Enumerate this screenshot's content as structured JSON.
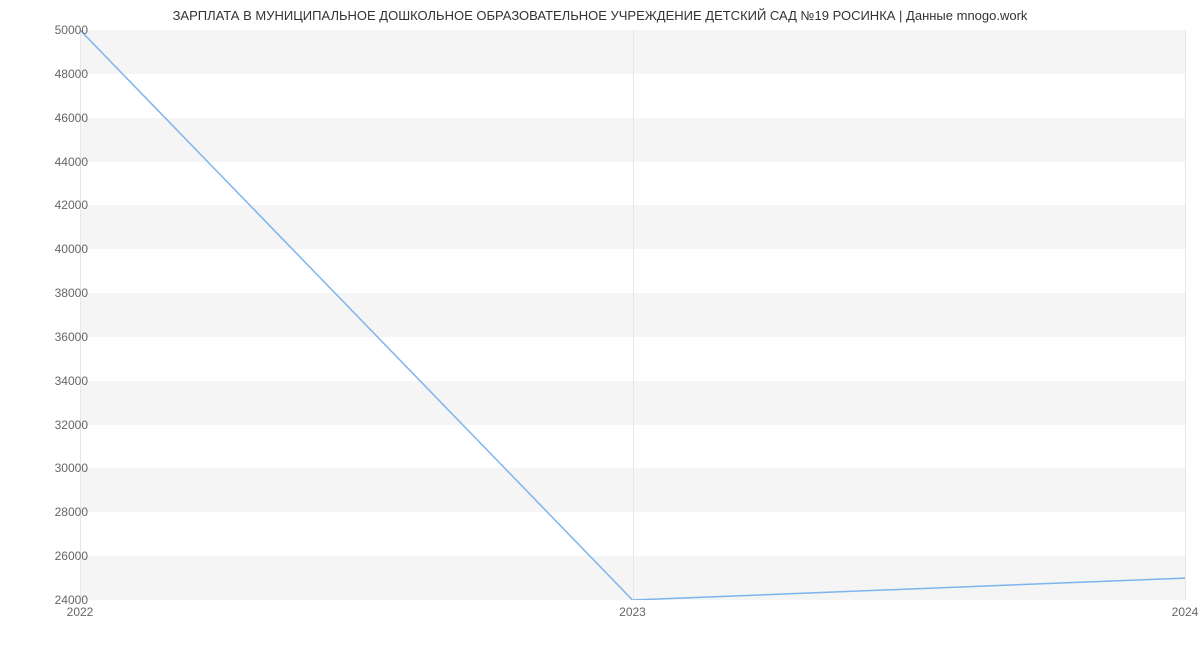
{
  "chart_data": {
    "type": "line",
    "title": "ЗАРПЛАТА В МУНИЦИПАЛЬНОЕ ДОШКОЛЬНОЕ ОБРАЗОВАТЕЛЬНОЕ УЧРЕЖДЕНИЕ ДЕТСКИЙ САД №19 РОСИНКА | Данные mnogo.work",
    "x": [
      2022,
      2023,
      2024
    ],
    "values": [
      50000,
      24000,
      25000
    ],
    "xlabel": "",
    "ylabel": "",
    "ylim": [
      24000,
      50000
    ],
    "x_ticks": [
      "2022",
      "2023",
      "2024"
    ],
    "y_ticks": [
      "24000",
      "26000",
      "28000",
      "30000",
      "32000",
      "34000",
      "36000",
      "38000",
      "40000",
      "42000",
      "44000",
      "46000",
      "48000",
      "50000"
    ]
  }
}
